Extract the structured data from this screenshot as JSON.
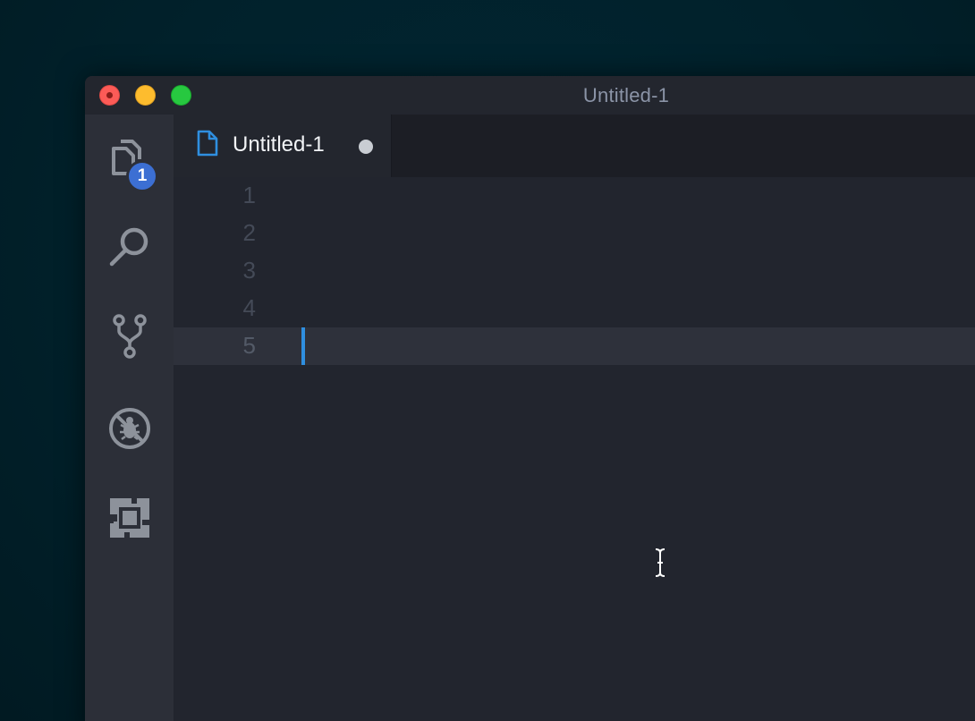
{
  "window": {
    "title": "Untitled-1"
  },
  "activity_bar": {
    "items": [
      {
        "id": "explorer",
        "icon": "files-icon",
        "badge": "1"
      },
      {
        "id": "search",
        "icon": "search-icon"
      },
      {
        "id": "source-control",
        "icon": "source-control-icon"
      },
      {
        "id": "debug",
        "icon": "debug-icon"
      },
      {
        "id": "extensions",
        "icon": "extensions-icon"
      }
    ]
  },
  "tabs": [
    {
      "label": "Untitled-1",
      "icon": "file-icon",
      "dirty": true,
      "active": true
    }
  ],
  "editor": {
    "line_numbers": [
      "1",
      "2",
      "3",
      "4",
      "5"
    ],
    "current_line": 5
  },
  "colors": {
    "accent": "#2f8fe0",
    "badge": "#3c6fd3",
    "close": "#fc5b57",
    "minimize": "#fdbc2e",
    "maximize": "#27c840"
  }
}
